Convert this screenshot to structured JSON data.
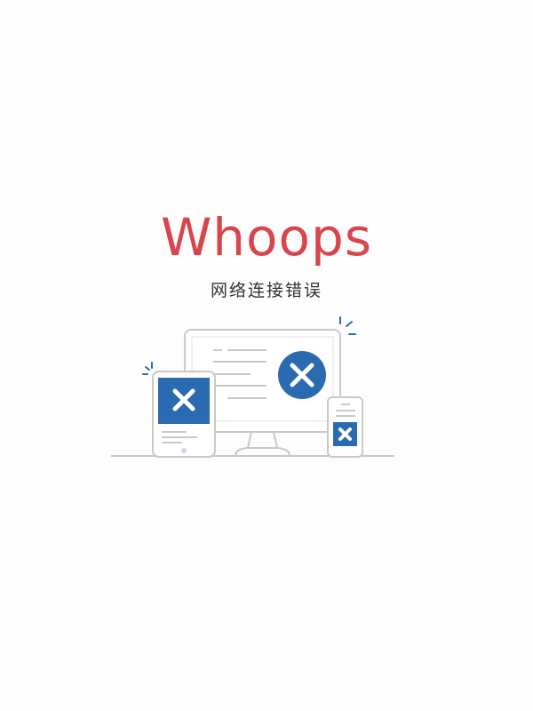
{
  "error": {
    "headline": "Whoops",
    "message": "网络连接错误"
  },
  "colors": {
    "headline": "#d9454c",
    "accent_blue": "#2a6ab1",
    "outline_gray": "#c8c8c8"
  },
  "illustration": {
    "icons": [
      "monitor-error-icon",
      "tablet-error-icon",
      "phone-error-icon"
    ]
  }
}
